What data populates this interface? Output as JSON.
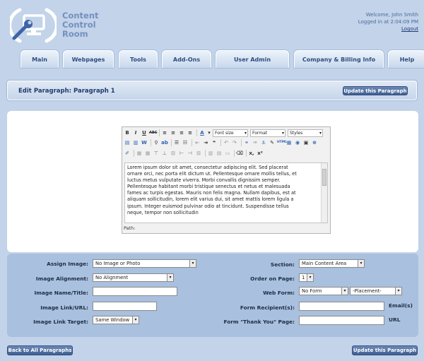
{
  "app": {
    "brand_lines": [
      "Content",
      "Control",
      "Room"
    ],
    "welcome": "Welcome, John Smith",
    "logged_in": "Logged in at 2:04:09 PM",
    "logout": "Logout"
  },
  "nav": {
    "tabs": [
      {
        "label": "Main"
      },
      {
        "label": "Webpages"
      },
      {
        "label": "Tools"
      },
      {
        "label": "Add-Ons"
      },
      {
        "label": "User Admin"
      },
      {
        "label": "Company & Billing Info"
      },
      {
        "label": "Help"
      }
    ]
  },
  "page": {
    "title": "Edit Paragraph: Paragraph 1",
    "update_label": "Update this Paragraph",
    "back_label": "Back to All Paragraphs"
  },
  "editor": {
    "font_size_label": "Font size",
    "format_label": "Format",
    "styles_label": "Styles",
    "content": "Lorem ipsum dolor sit amet, consectetur adipiscing elit. Sed placerat ornare orci, nec porta elit dictum ut. Pellentesque ornare mollis tellus, et luctus metus vulputate viverra. Morbi convallis dignissim semper. Pellentesque habitant morbi tristique senectus et netus et malesuada fames ac turpis egestas. Mauris non felis magna. Nullam dapibus, est at aliquam sollicitudin, lorem elit varius dui, sit amet mattis lorem ligula a ipsum. Integer euismod pulvinar odio at tincidunt. Suspendisse tellus neque, tempor non sollicitudin",
    "path_label": "Path:"
  },
  "form": {
    "assign_image": {
      "label": "Assign Image:",
      "value": "No Image or Photo"
    },
    "image_alignment": {
      "label": "Image Alignment:",
      "value": "No Alignment"
    },
    "image_name": {
      "label": "Image Name/Title:",
      "value": ""
    },
    "image_link": {
      "label": "Image Link/URL:",
      "value": ""
    },
    "image_link_target": {
      "label": "Image Link Target:",
      "value": "Same Window"
    },
    "section": {
      "label": "Section:",
      "value": "Main Content Area"
    },
    "order": {
      "label": "Order on Page:",
      "value": "1"
    },
    "web_form": {
      "label": "Web Form:",
      "value": "No Form",
      "placement": "-Placement-"
    },
    "recipients": {
      "label": "Form Recipient(s):",
      "value": "",
      "hint": "Email(s)"
    },
    "thankyou": {
      "label": "Form \"Thank You\" Page:",
      "value": "",
      "hint": "URL"
    }
  }
}
